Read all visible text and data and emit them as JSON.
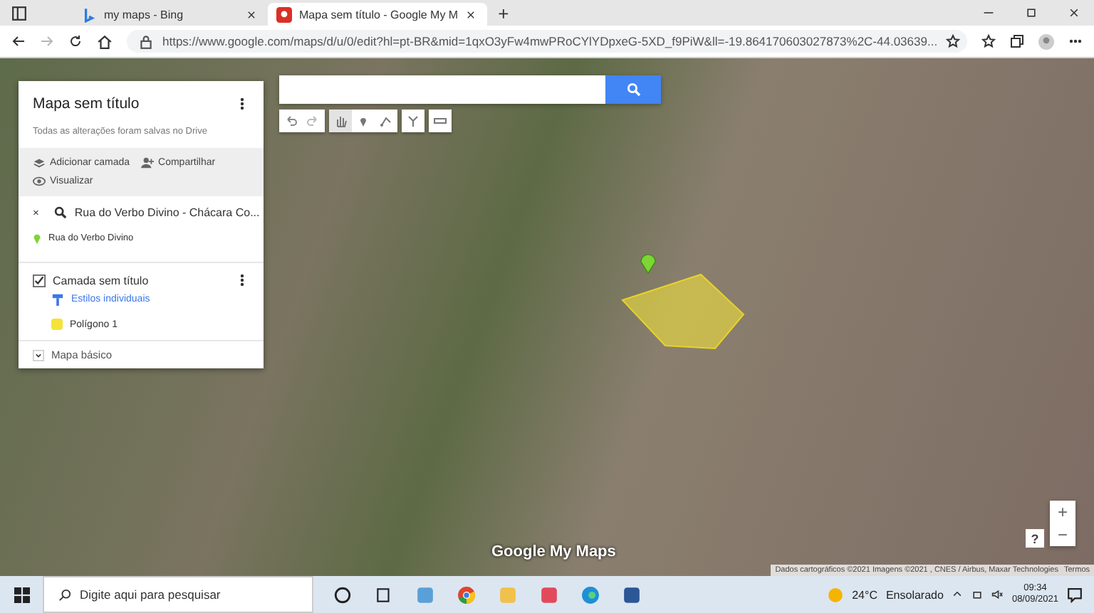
{
  "browser": {
    "tabs": [
      {
        "title": "my maps - Bing",
        "selected": false
      },
      {
        "title": "Mapa sem título - Google My M",
        "selected": true
      }
    ],
    "new_tab": "+",
    "url": "https://www.google.com/maps/d/u/0/edit?hl=pt-BR&mid=1qxO3yFw4mwPRoCYlYDpxeG-5XD_f9PiW&ll=-19.864170603027873%2C-44.03639..."
  },
  "panel": {
    "title": "Mapa sem título",
    "subtitle": "Todas as alterações foram salvas no Drive",
    "actions": [
      {
        "kind": "layer",
        "label": "Adicionar camada"
      },
      {
        "kind": "share",
        "label": "Compartilhar"
      },
      {
        "kind": "preview",
        "label": "Visualizar"
      }
    ],
    "search": {
      "close": "×",
      "query": "Rua do Verbo Divino - Chácara Co...",
      "result": "Rua do Verbo Divino"
    },
    "layer": {
      "name": "Camada sem título",
      "checked": true,
      "style": "Estilos individuais",
      "items": [
        {
          "label": "Polígono 1",
          "color": "#f5e33a"
        }
      ]
    },
    "base_map": "Mapa básico"
  },
  "map": {
    "tools": [
      {
        "kind": "undo",
        "selected": false
      },
      {
        "kind": "redo",
        "selected": false
      },
      {
        "kind": "hand",
        "selected": true
      },
      {
        "kind": "marker",
        "selected": false
      },
      {
        "kind": "line",
        "selected": false
      },
      {
        "kind": "route",
        "selected": false
      },
      {
        "kind": "ruler",
        "selected": false
      }
    ],
    "logo": "Google My Maps",
    "attribution": "Dados cartográficos ©2021 Imagens ©2021 , CNES / Airbus, Maxar Technologies",
    "terms": "Termos",
    "zoom_in": "+",
    "zoom_out": "−",
    "help": "?"
  },
  "taskbar": {
    "search_placeholder": "Digite aqui para pesquisar",
    "temperature": "24°C",
    "weather": "Ensolarado",
    "time": "09:34",
    "date": "08/09/2021"
  }
}
